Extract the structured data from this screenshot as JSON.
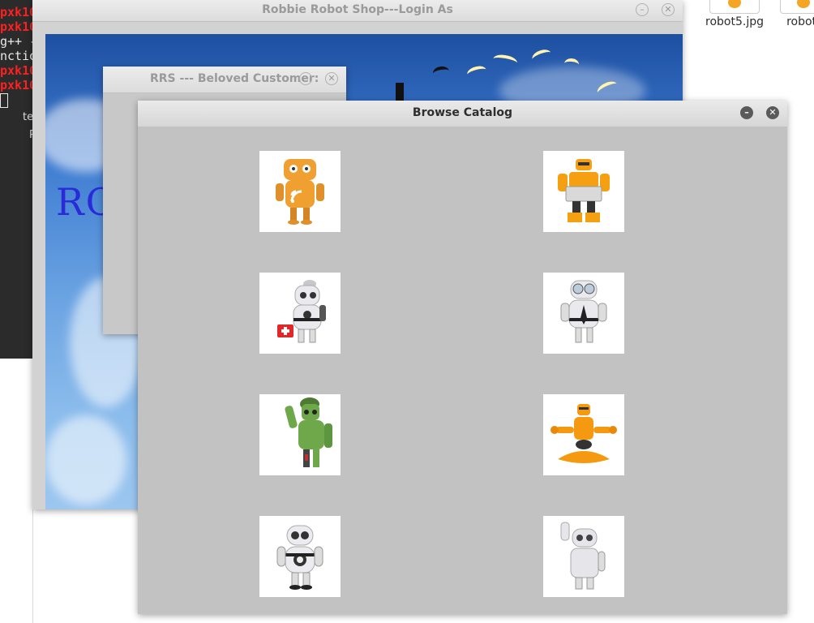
{
  "terminal": {
    "lines": [
      "pxk10",
      "pxk10",
      "g++ -",
      "nctio",
      "pxk10",
      "pxk10"
    ],
    "fragment_1": "te",
    "fragment_2": "P"
  },
  "desktop": {
    "icons": [
      {
        "label": "robot5.jpg"
      },
      {
        "label": "robot6"
      }
    ]
  },
  "login_window": {
    "title": "Robbie Robot Shop---Login As",
    "logo_partial": "RO"
  },
  "customer_window": {
    "title": "RRS --- Beloved Customer:"
  },
  "catalog_window": {
    "title": "Browse Catalog",
    "items": [
      {
        "icon": "orange-rss-robot-icon",
        "color": "#f0a030"
      },
      {
        "icon": "orange-laptop-robot-icon",
        "color": "#f5a010"
      },
      {
        "icon": "white-doctor-robot-icon",
        "color": "#e9e9ee"
      },
      {
        "icon": "white-goggles-robot-icon",
        "color": "#e9e9ee"
      },
      {
        "icon": "green-soldier-robot-icon",
        "color": "#6fa84a"
      },
      {
        "icon": "orange-meditating-robot-icon",
        "color": "#f59a10"
      },
      {
        "icon": "white-round-robot-icon",
        "color": "#ececf0"
      },
      {
        "icon": "white-waving-robot-icon",
        "color": "#e6e6ea"
      }
    ]
  }
}
